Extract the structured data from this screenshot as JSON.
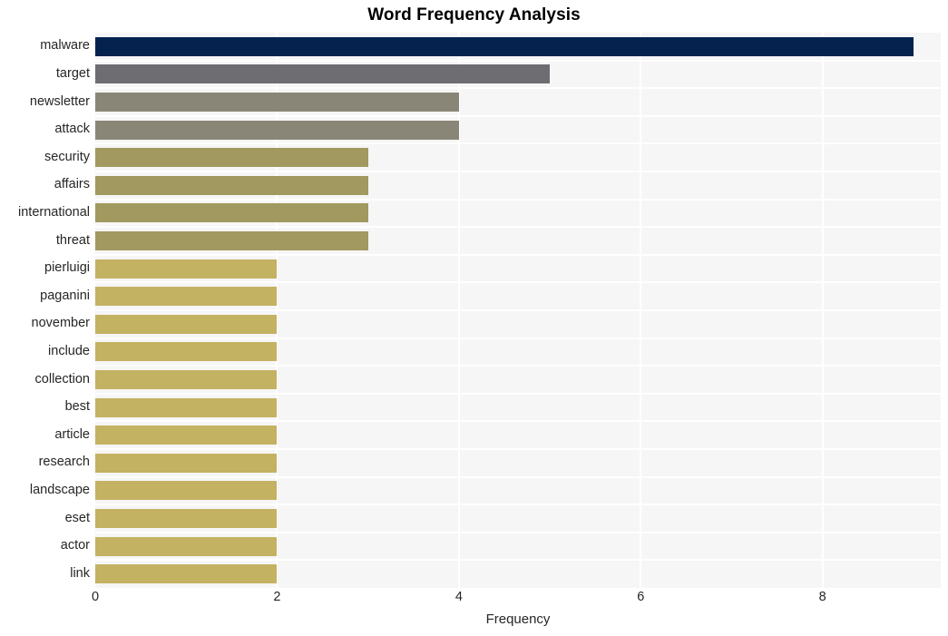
{
  "chart_data": {
    "type": "bar",
    "orientation": "horizontal",
    "title": "Word Frequency Analysis",
    "xlabel": "Frequency",
    "ylabel": "",
    "xlim": [
      0,
      9.3
    ],
    "xticks": [
      0,
      2,
      4,
      6,
      8
    ],
    "xtick_labels": [
      "0",
      "2",
      "4",
      "6",
      "8"
    ],
    "grid": true,
    "legend": "none",
    "categories": [
      "malware",
      "target",
      "newsletter",
      "attack",
      "security",
      "affairs",
      "international",
      "threat",
      "pierluigi",
      "paganini",
      "november",
      "include",
      "collection",
      "best",
      "article",
      "research",
      "landscape",
      "eset",
      "actor",
      "link"
    ],
    "values": [
      9,
      5,
      4,
      4,
      3,
      3,
      3,
      3,
      2,
      2,
      2,
      2,
      2,
      2,
      2,
      2,
      2,
      2,
      2,
      2
    ],
    "bar_colors": [
      "#05224f",
      "#6e6e72",
      "#8a8677",
      "#8a8677",
      "#a1995f",
      "#a1995f",
      "#a1995f",
      "#a1995f",
      "#c4b263",
      "#c4b263",
      "#c4b263",
      "#c4b263",
      "#c4b263",
      "#c4b263",
      "#c4b263",
      "#c4b263",
      "#c4b263",
      "#c4b263",
      "#c4b263",
      "#c4b263"
    ],
    "plot_background": "#f6f6f6",
    "gridline_color": "#ffffff",
    "text_color": "#262626",
    "figure_background": "#ffffff"
  }
}
